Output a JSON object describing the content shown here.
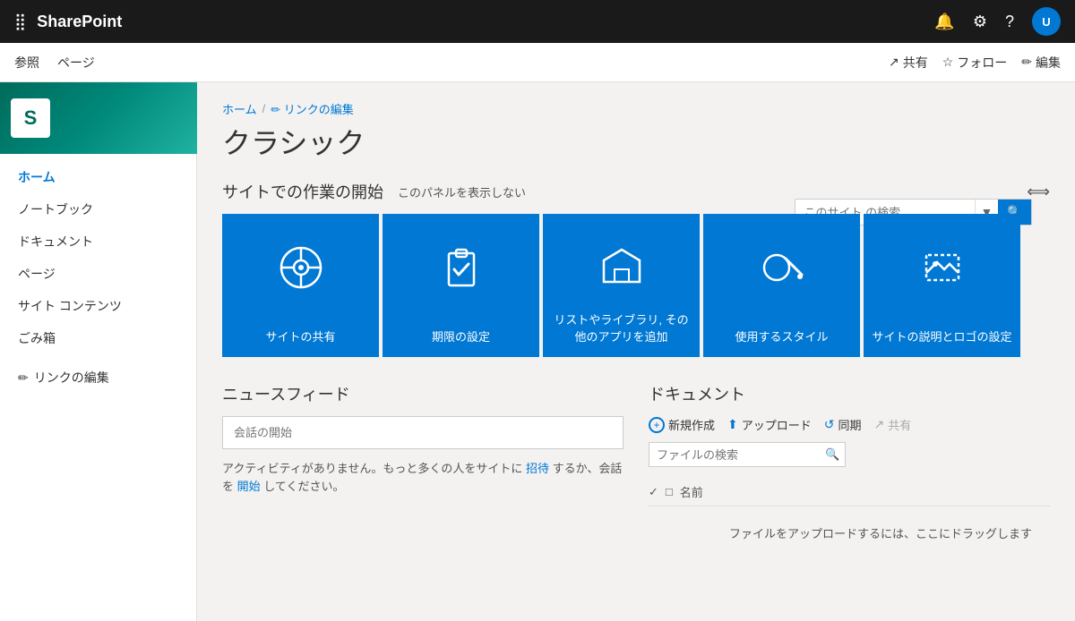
{
  "topbar": {
    "app_launcher_icon": "⣿",
    "site_name": "SharePoint",
    "notification_icon": "🔔",
    "settings_icon": "⚙",
    "help_icon": "?",
    "avatar_initials": "U"
  },
  "secondary_nav": {
    "items": [
      "参照",
      "ページ"
    ],
    "actions": [
      {
        "label": "共有",
        "icon": "share"
      },
      {
        "label": "フォロー",
        "icon": "star"
      },
      {
        "label": "編集",
        "icon": "pencil"
      }
    ]
  },
  "sidebar": {
    "nav_items": [
      {
        "label": "ホーム",
        "active": true
      },
      {
        "label": "ノートブック",
        "active": false
      },
      {
        "label": "ドキュメント",
        "active": false
      },
      {
        "label": "ページ",
        "active": false
      },
      {
        "label": "サイト コンテンツ",
        "active": false
      },
      {
        "label": "ごみ箱",
        "active": false
      }
    ],
    "edit_link_label": "リンクの編集"
  },
  "breadcrumb": {
    "home": "ホーム",
    "separator": "/",
    "edit_link": "✏ リンクの編集"
  },
  "page_title": "クラシック",
  "search": {
    "placeholder": "このサイト の検索"
  },
  "getting_started": {
    "title": "サイトでの作業の開始",
    "hide_label": "このパネルを表示しない",
    "scroll_icon": "⟺",
    "cards": [
      {
        "label": "サイトの共有",
        "icon": "share_card"
      },
      {
        "label": "期限の設定",
        "icon": "clipboard"
      },
      {
        "label": "リストやライブラリ, その他のアプリを追加",
        "icon": "house_hex"
      },
      {
        "label": "使用するスタイル",
        "icon": "palette"
      },
      {
        "label": "サイトの説明とロゴの設定",
        "icon": "image"
      }
    ]
  },
  "newsfeed": {
    "title": "ニュースフィード",
    "input_placeholder": "会話の開始",
    "empty_message": "アクティビティがありません。もっと多くの人をサイトに",
    "invite_link": "招待",
    "or_text": "するか、会話を",
    "start_link": "開始",
    "end_text": "してください。"
  },
  "documents": {
    "title": "ドキュメント",
    "actions": [
      {
        "label": "新規作成",
        "type": "add"
      },
      {
        "label": "アップロード",
        "type": "upload"
      },
      {
        "label": "同期",
        "type": "sync"
      },
      {
        "label": "共有",
        "type": "share",
        "disabled": true
      }
    ],
    "search_placeholder": "ファイルの検索",
    "column_check": "✓",
    "column_file": "□",
    "column_name": "名前",
    "empty_drop_label": "ファイルをアップロードするには、ここにドラッグします"
  }
}
